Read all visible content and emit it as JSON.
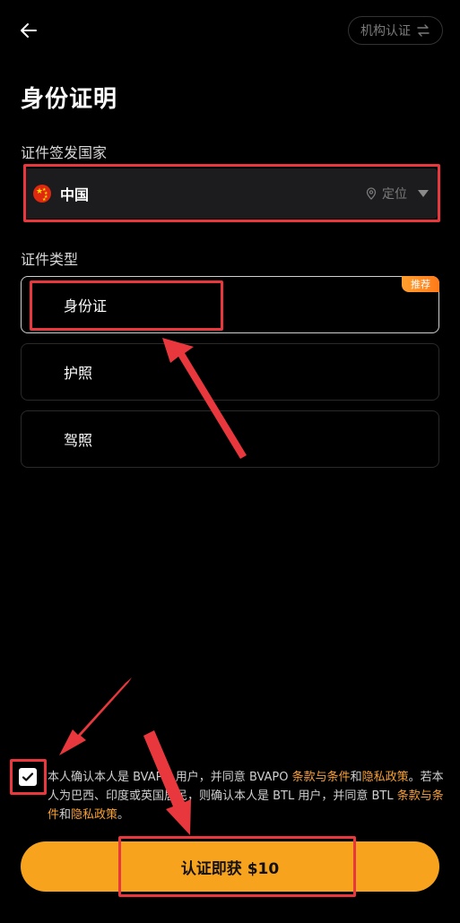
{
  "header": {
    "institution_label": "机构认证"
  },
  "page": {
    "title": "身份证明"
  },
  "country_section": {
    "label": "证件签发国家",
    "selected_country": "中国",
    "locate_label": "定位"
  },
  "type_section": {
    "label": "证件类型",
    "options": [
      {
        "label": "身份证",
        "badge": "推荐",
        "selected": true
      },
      {
        "label": "护照",
        "selected": false
      },
      {
        "label": "驾照",
        "selected": false
      }
    ]
  },
  "agreement": {
    "checked": true,
    "part1": "本人确认本人是 BVAPO 用户，并同意 BVAPO ",
    "link1": "条款与条件",
    "and1": "和",
    "link2": "隐私政策",
    "part2": "。若本人为巴西、印度或英国居民，则确认本人是 BTL 用户，并同意 BTL ",
    "link3": "条款与条件",
    "and2": "和",
    "link4": "隐私政策",
    "end": "。"
  },
  "cta": {
    "label": "认证即获 $10"
  },
  "colors": {
    "accent": "#f7a31d",
    "link": "#f7a035",
    "annotation_red": "#e8383d",
    "background": "#000000"
  }
}
